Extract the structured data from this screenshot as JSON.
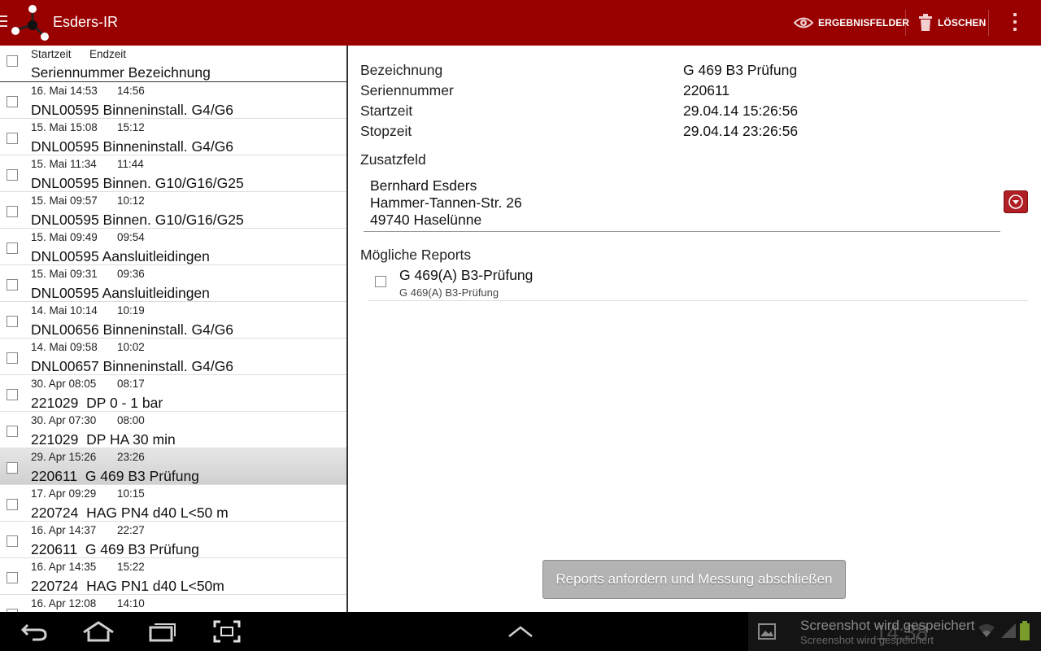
{
  "app": {
    "title": "Esders-IR"
  },
  "actions": {
    "result_fields": "ERGEBNISFELDER",
    "delete": "LÖSCHEN"
  },
  "list": {
    "header": {
      "start": "Startzeit",
      "end": "Endzeit",
      "title": "Seriennummer Bezeichnung"
    },
    "rows": [
      {
        "start": "16. Mai 14:53",
        "end": "14:56",
        "title": "DNL00595 Binneninstall. G4/G6"
      },
      {
        "start": "15. Mai 15:08",
        "end": "15:12",
        "title": "DNL00595 Binneninstall. G4/G6"
      },
      {
        "start": "15. Mai 11:34",
        "end": "11:44",
        "title": "DNL00595 Binnen. G10/G16/G25"
      },
      {
        "start": "15. Mai 09:57",
        "end": "10:12",
        "title": "DNL00595 Binnen. G10/G16/G25"
      },
      {
        "start": "15. Mai 09:49",
        "end": "09:54",
        "title": "DNL00595 Aansluitleidingen"
      },
      {
        "start": "15. Mai 09:31",
        "end": "09:36",
        "title": "DNL00595 Aansluitleidingen"
      },
      {
        "start": "14. Mai 10:14",
        "end": "10:19",
        "title": "DNL00656 Binneninstall. G4/G6"
      },
      {
        "start": "14. Mai 09:58",
        "end": "10:02",
        "title": "DNL00657 Binneninstall. G4/G6"
      },
      {
        "start": "30. Apr 08:05",
        "end": "08:17",
        "title": "221029  DP 0 - 1 bar"
      },
      {
        "start": "30. Apr 07:30",
        "end": "08:00",
        "title": "221029  DP HA 30 min"
      },
      {
        "start": "29. Apr 15:26",
        "end": "23:26",
        "title": "220611  G 469 B3 Prüfung"
      },
      {
        "start": "17. Apr 09:29",
        "end": "10:15",
        "title": "220724  HAG PN4 d40 L<50 m"
      },
      {
        "start": "16. Apr 14:37",
        "end": "22:27",
        "title": "220611  G 469 B3 Prüfung"
      },
      {
        "start": "16. Apr 14:35",
        "end": "15:22",
        "title": "220724  HAG PN1 d40 L<50m"
      },
      {
        "start": "16. Apr 12:08",
        "end": "14:10",
        "title": ""
      }
    ]
  },
  "detail": {
    "fields": [
      {
        "label": "Bezeichnung",
        "value": "G 469 B3 Prüfung"
      },
      {
        "label": "Seriennummer",
        "value": "220611"
      },
      {
        "label": "Startzeit",
        "value": "29.04.14 15:26:56"
      },
      {
        "label": "Stopzeit",
        "value": "29.04.14 23:26:56"
      }
    ],
    "extra_label": "Zusatzfeld",
    "address": [
      "Bernhard Esders",
      "Hammer-Tannen-Str. 26",
      "49740 Haselünne"
    ],
    "reports_label": "Mögliche Reports",
    "report": {
      "title": "G 469(A) B3-Prüfung",
      "subtitle": "G 469(A) B3-Prüfung"
    },
    "submit_label": "Reports anfordern und Messung abschließen"
  },
  "statusbar": {
    "notification_title": "Screenshot wird gespeichert",
    "notification_sub": "Screenshot wird gespeichert",
    "clock": "14:38"
  },
  "colors": {
    "actionbar": "#990000",
    "accent_button": "#b01f24",
    "submit_bg": "#b3b3b3"
  },
  "icons": [
    "menu-icon",
    "app-logo-icon",
    "eye-icon",
    "trash-icon",
    "overflow-icon",
    "dropdown-icon",
    "back-icon",
    "home-icon",
    "recents-icon",
    "screenshot-icon",
    "up-chevron-icon",
    "image-icon",
    "wifi-icon",
    "signal-icon",
    "battery-icon"
  ]
}
